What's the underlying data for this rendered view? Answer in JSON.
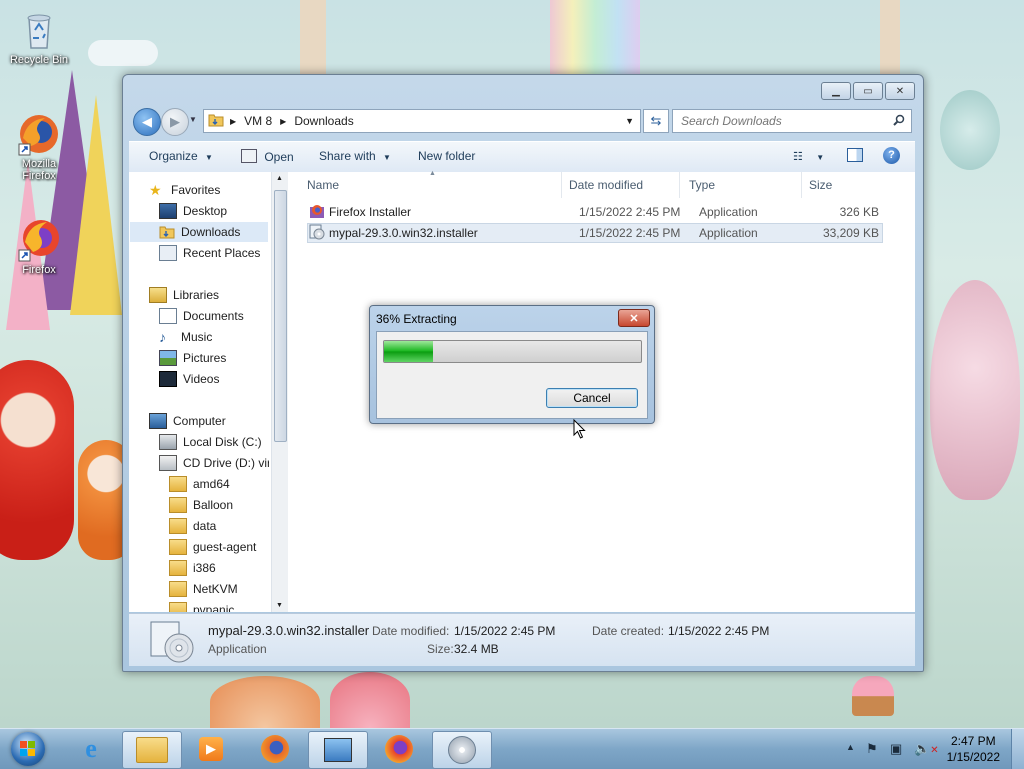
{
  "desktop": {
    "icons": [
      {
        "label": "Recycle Bin"
      },
      {
        "label": "Mozilla Firefox"
      },
      {
        "label": "Firefox"
      }
    ]
  },
  "explorer": {
    "breadcrumb": [
      "VM 8",
      "Downloads"
    ],
    "search_placeholder": "Search Downloads",
    "toolbar": {
      "organize": "Organize",
      "open": "Open",
      "share_with": "Share with",
      "new_folder": "New folder"
    },
    "nav": {
      "favorites": "Favorites",
      "favorites_items": [
        "Desktop",
        "Downloads",
        "Recent Places"
      ],
      "libraries": "Libraries",
      "libraries_items": [
        "Documents",
        "Music",
        "Pictures",
        "Videos"
      ],
      "computer": "Computer",
      "drives": [
        "Local Disk (C:)",
        "CD Drive (D:) virt"
      ],
      "cd_folders": [
        "amd64",
        "Balloon",
        "data",
        "guest-agent",
        "i386",
        "NetKVM",
        "pvpanic"
      ]
    },
    "columns": {
      "name": "Name",
      "date": "Date modified",
      "type": "Type",
      "size": "Size"
    },
    "files": [
      {
        "name": "Firefox Installer",
        "date": "1/15/2022 2:45 PM",
        "type": "Application",
        "size": "326 KB"
      },
      {
        "name": "mypal-29.3.0.win32.installer",
        "date": "1/15/2022 2:45 PM",
        "type": "Application",
        "size": "33,209 KB"
      }
    ],
    "details": {
      "name": "mypal-29.3.0.win32.installer",
      "kind": "Application",
      "date_modified_label": "Date modified:",
      "date_modified": "1/15/2022 2:45 PM",
      "date_created_label": "Date created:",
      "date_created": "1/15/2022 2:45 PM",
      "size_label": "Size:",
      "size": "32.4 MB"
    }
  },
  "dialog": {
    "title": "36% Extracting",
    "progress": 0.19,
    "cancel_label": "Cancel"
  },
  "taskbar": {
    "time": "2:47 PM",
    "date": "1/15/2022"
  },
  "colors": {
    "accent": "#3a6ea5",
    "progress_green": "#16b51c",
    "close_red": "#c7472f"
  }
}
